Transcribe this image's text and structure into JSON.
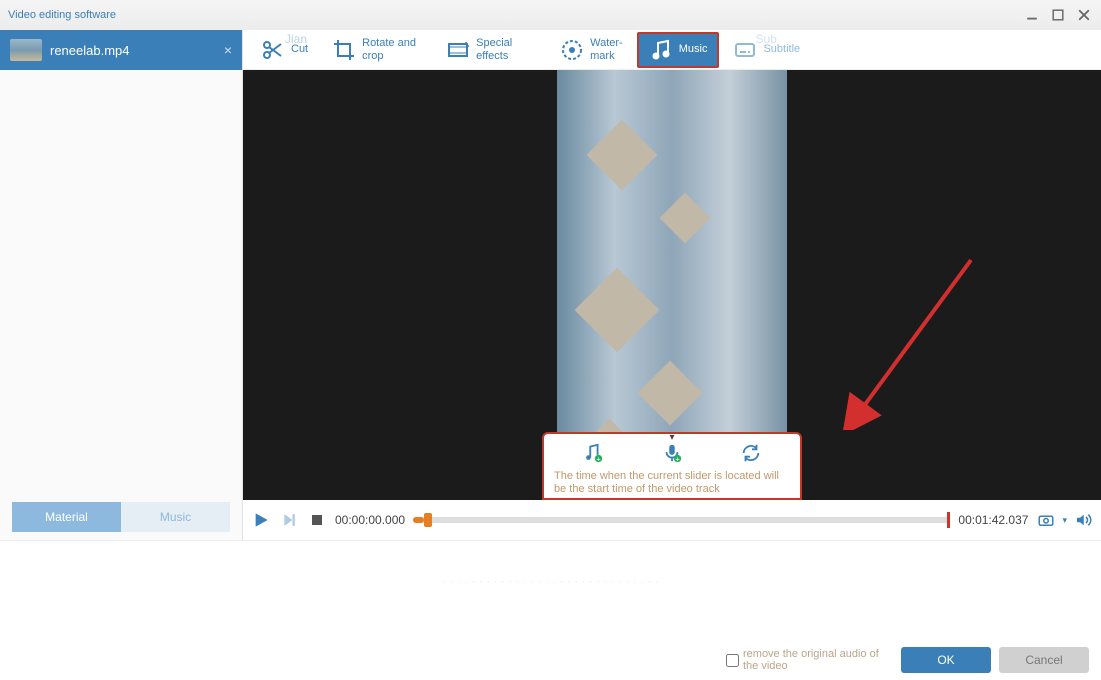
{
  "window": {
    "title": "Video editing software"
  },
  "file": {
    "name": "reneelab.mp4"
  },
  "toolbar": {
    "cut_ghost": "Jian",
    "cut": "Cut",
    "rotate": "Rotate and crop",
    "effects": "Special effects",
    "watermark": "Water-\nmark",
    "music": "Music",
    "subtitle_ghost": "Sub",
    "subtitle": "Subtitle"
  },
  "sidebar": {
    "tabs": {
      "material": "Material",
      "music": "Music"
    }
  },
  "player": {
    "current_time": "00:00:00.000",
    "total_time": "00:01:42.037"
  },
  "popup": {
    "tip": "The time when the current slider is located will be the start time of the video track"
  },
  "footer": {
    "remove_audio": "remove the original audio of the video",
    "ok": "OK",
    "cancel": "Cancel"
  }
}
